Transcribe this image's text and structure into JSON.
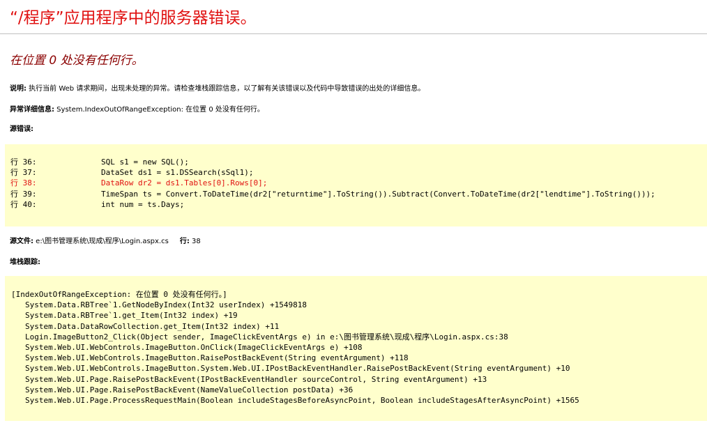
{
  "title": "“/程序”应用程序中的服务器错误。",
  "subtitle": "在位置 0 处没有任何行。",
  "description": {
    "label": "说明:",
    "text": " 执行当前 Web 请求期间，出现未处理的异常。请检查堆栈跟踪信息，以了解有关该错误以及代码中导致错误的出处的详细信息。"
  },
  "exception_details": {
    "label": "异常详细信息:",
    "text": " System.IndexOutOfRangeException: 在位置 0 处没有任何行。"
  },
  "source_error": {
    "label": "源错误:",
    "lines": [
      {
        "line": "行 36:",
        "code": "SQL s1 = new SQL();",
        "error": false
      },
      {
        "line": "行 37:",
        "code": "DataSet ds1 = s1.DSSearch(sSql1);",
        "error": false
      },
      {
        "line": "行 38:",
        "code": "DataRow dr2 = ds1.Tables[0].Rows[0];",
        "error": true
      },
      {
        "line": "行 39:",
        "code": "TimeSpan ts = Convert.ToDateTime(dr2[\"returntime\"].ToString()).Subtract(Convert.ToDateTime(dr2[\"lendtime\"].ToString()));",
        "error": false
      },
      {
        "line": "行 40:",
        "code": "int num = ts.Days;",
        "error": false
      }
    ]
  },
  "source_file": {
    "label": "源文件:",
    "path": " e:\\图书管理系统\\现成\\程序\\Login.aspx.cs",
    "line_label": "行:",
    "line_value": " 38"
  },
  "stack_trace": {
    "label": "堆栈跟踪:",
    "header": "[IndexOutOfRangeException: 在位置 0 处没有任何行。]",
    "frames": [
      "System.Data.RBTree`1.GetNodeByIndex(Int32 userIndex) +1549818",
      "System.Data.RBTree`1.get_Item(Int32 index) +19",
      "System.Data.DataRowCollection.get_Item(Int32 index) +11",
      "Login.ImageButton2_Click(Object sender, ImageClickEventArgs e) in e:\\图书管理系统\\现成\\程序\\Login.aspx.cs:38",
      "System.Web.UI.WebControls.ImageButton.OnClick(ImageClickEventArgs e) +108",
      "System.Web.UI.WebControls.ImageButton.RaisePostBackEvent(String eventArgument) +118",
      "System.Web.UI.WebControls.ImageButton.System.Web.UI.IPostBackEventHandler.RaisePostBackEvent(String eventArgument) +10",
      "System.Web.UI.Page.RaisePostBackEvent(IPostBackEventHandler sourceControl, String eventArgument) +13",
      "System.Web.UI.Page.RaisePostBackEvent(NameValueCollection postData) +36",
      "System.Web.UI.Page.ProcessRequestMain(Boolean includeStagesBeforeAsyncPoint, Boolean includeStagesAfterAsyncPoint) +1565"
    ]
  },
  "colors": {
    "title": "#e01010",
    "subtitle": "#8b0000",
    "code_background": "#ffffcc",
    "error_line": "#e01010"
  }
}
